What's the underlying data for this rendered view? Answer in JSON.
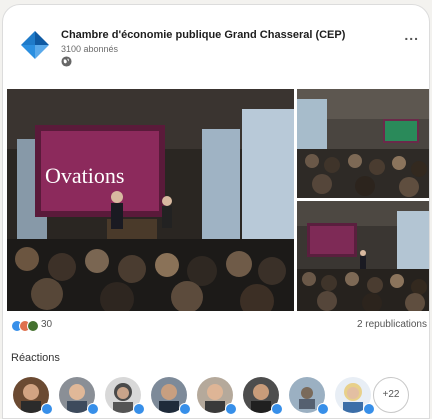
{
  "post": {
    "org_name": "Chambre d'économie publique Grand Chasseral (CEP)",
    "followers": "3100 abonnés",
    "visibility_icon": "globe-icon",
    "more_label": "...",
    "photos": [
      {
        "name": "photo-main",
        "screen_text": "Ovations"
      },
      {
        "name": "photo-top-right"
      },
      {
        "name": "photo-bottom-right"
      }
    ]
  },
  "social": {
    "reaction_icons": [
      "like-icon",
      "love-icon",
      "celebrate-icon"
    ],
    "reaction_count": "30",
    "reposts": "2 republications"
  },
  "reactions": {
    "title": "Réactions",
    "more_count": "+22"
  },
  "colors": {
    "accent": "#378fe9",
    "logo_blue": "#1569b8"
  }
}
